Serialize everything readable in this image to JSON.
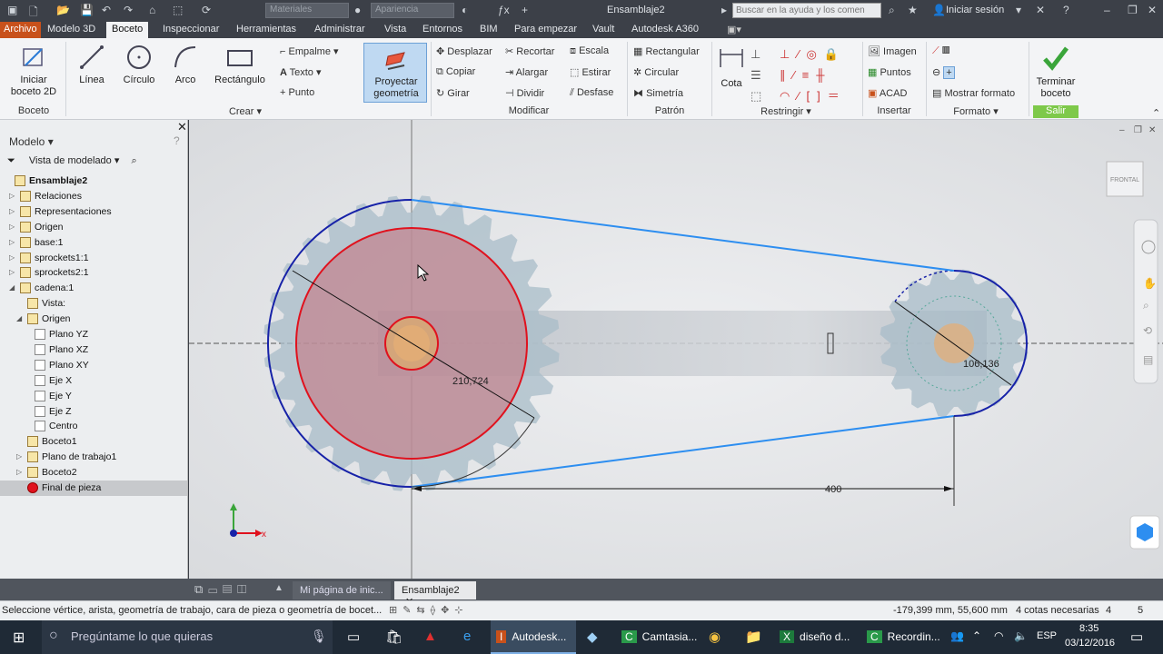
{
  "titlebar": {
    "doc_title": "Ensamblaje2",
    "material_dropdown": "Materiales",
    "appearance_dropdown": "Apariencia",
    "help_search_placeholder": "Buscar en la ayuda y los comen",
    "sign_in": "Iniciar sesión"
  },
  "menu": {
    "tabs": [
      "Archivo",
      "Modelo 3D",
      "Boceto",
      "Inspeccionar",
      "Herramientas",
      "Administrar",
      "Vista",
      "Entornos",
      "BIM",
      "Para empezar",
      "Vault",
      "Autodesk A360"
    ],
    "active": "Boceto"
  },
  "ribbon": {
    "boceto": {
      "start_sketch": "Iniciar boceto 2D",
      "panel": "Boceto"
    },
    "crear": {
      "line": "Línea",
      "circle": "Círculo",
      "arc": "Arco",
      "rectangle": "Rectángulo",
      "fillet": "Empalme",
      "text": "Texto",
      "point": "Punto",
      "panel": "Crear"
    },
    "project": "Proyectar geometría",
    "modificar": {
      "move": "Desplazar",
      "copy": "Copiar",
      "rotate": "Girar",
      "trim": "Recortar",
      "extend": "Alargar",
      "split": "Dividir",
      "scale": "Escala",
      "stretch": "Estirar",
      "offset": "Desfase",
      "panel": "Modificar"
    },
    "patron": {
      "rect": "Rectangular",
      "circ": "Circular",
      "mirror": "Simetría",
      "panel": "Patrón"
    },
    "restringir": {
      "dimension": "Cota",
      "panel": "Restringir"
    },
    "insertar": {
      "image": "Imagen",
      "points": "Puntos",
      "acad": "ACAD",
      "panel": "Insertar"
    },
    "formato": {
      "show_format": "Mostrar formato",
      "panel": "Formato"
    },
    "salir": {
      "finish": "Terminar boceto",
      "panel": "Salir"
    }
  },
  "browser": {
    "title": "Modelo",
    "view_label": "Vista de modelado",
    "items": [
      {
        "label": "Ensamblaje2",
        "level": 0,
        "bold": true
      },
      {
        "label": "Relaciones",
        "level": 1
      },
      {
        "label": "Representaciones",
        "level": 1
      },
      {
        "label": "Origen",
        "level": 1
      },
      {
        "label": "base:1",
        "level": 1
      },
      {
        "label": "sprockets1:1",
        "level": 1
      },
      {
        "label": "sprockets2:1",
        "level": 1
      },
      {
        "label": "cadena:1",
        "level": 1
      },
      {
        "label": "Vista:",
        "level": 2
      },
      {
        "label": "Origen",
        "level": 2
      },
      {
        "label": "Plano YZ",
        "level": 3
      },
      {
        "label": "Plano XZ",
        "level": 3
      },
      {
        "label": "Plano XY",
        "level": 3
      },
      {
        "label": "Eje X",
        "level": 3
      },
      {
        "label": "Eje Y",
        "level": 3
      },
      {
        "label": "Eje Z",
        "level": 3
      },
      {
        "label": "Centro",
        "level": 3
      },
      {
        "label": "Boceto1",
        "level": 2
      },
      {
        "label": "Plano de trabajo1",
        "level": 2
      },
      {
        "label": "Boceto2",
        "level": 2
      },
      {
        "label": "Final de pieza",
        "level": 2,
        "selected": true
      }
    ]
  },
  "viewport": {
    "viewcube_label": "FRONTAL",
    "dim_large": "210,724",
    "dim_small": "106,136",
    "dim_distance": "400",
    "axis_x": "x"
  },
  "doc_tabs": [
    "Mi página de inic...",
    "Ensamblaje2"
  ],
  "status": {
    "prompt": "Seleccione vértice, arista, geometría de trabajo, cara de pieza o geometría de bocet...",
    "coords": "-179,399 mm, 55,600 mm",
    "dims_needed": "4 cotas necesarias",
    "n1": "4",
    "n2": "5"
  },
  "taskbar": {
    "search": "Pregúntame lo que quieras",
    "apps": [
      "Autodesk...",
      "Camtasia...",
      "diseño d...",
      "Recordin..."
    ],
    "lang": "ESP",
    "time": "8:35",
    "date": "03/12/2016"
  },
  "colors": {
    "accent": "#c8511b",
    "finish_green": "#7ec94a",
    "sketch_red": "#e0121e",
    "sketch_blue": "#1722a8",
    "chain_blue": "#2d8ef0"
  }
}
